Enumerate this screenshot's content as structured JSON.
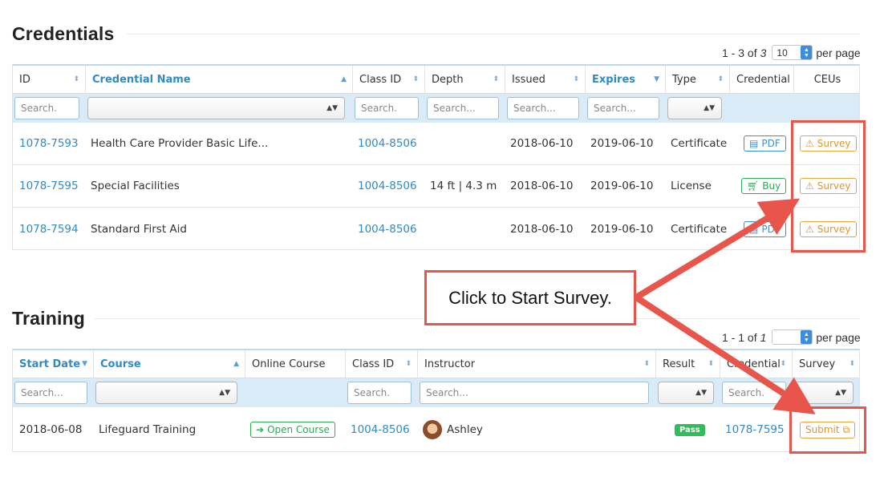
{
  "credentials": {
    "title": "Credentials",
    "pager": {
      "range": "1 - 3 of",
      "total": "3",
      "per_page_value": "10",
      "per_page_label": "per page"
    },
    "columns": [
      {
        "label": "ID",
        "sort": "both"
      },
      {
        "label": "Credential Name",
        "sort": "asc"
      },
      {
        "label": "Class ID",
        "sort": "both"
      },
      {
        "label": "Depth",
        "sort": "both"
      },
      {
        "label": "Issued",
        "sort": "both"
      },
      {
        "label": "Expires",
        "sort": "desc"
      },
      {
        "label": "Type",
        "sort": "both"
      },
      {
        "label": "Credential",
        "sort": "none"
      },
      {
        "label": "CEUs",
        "sort": "none"
      }
    ],
    "filters": {
      "id": "Search.",
      "class_id": "Search.",
      "depth": "Search...",
      "issued": "Search...",
      "expires": "Search..."
    },
    "rows": [
      {
        "id": "1078-7593",
        "name": "Health Care Provider Basic Life...",
        "class_id": "1004-8506",
        "depth": "",
        "issued": "2018-06-10",
        "expires": "2019-06-10",
        "type": "Certificate",
        "credential_btn": "PDF",
        "credential_kind": "pdf",
        "ceus_btn": "Survey"
      },
      {
        "id": "1078-7595",
        "name": "Special Facilities",
        "class_id": "1004-8506",
        "depth": "14 ft | 4.3 m",
        "issued": "2018-06-10",
        "expires": "2019-06-10",
        "type": "License",
        "credential_btn": "Buy",
        "credential_kind": "buy",
        "ceus_btn": "Survey"
      },
      {
        "id": "1078-7594",
        "name": "Standard First Aid",
        "class_id": "1004-8506",
        "depth": "",
        "issued": "2018-06-10",
        "expires": "2019-06-10",
        "type": "Certificate",
        "credential_btn": "PDF",
        "credential_kind": "pdf",
        "ceus_btn": "Survey"
      }
    ]
  },
  "training": {
    "title": "Training",
    "pager": {
      "range": "1 - 1 of",
      "total": "1",
      "per_page_value": "",
      "per_page_label": "per page"
    },
    "columns": [
      {
        "label": "Start Date",
        "sort": "desc"
      },
      {
        "label": "Course",
        "sort": "asc"
      },
      {
        "label": "Online Course",
        "sort": "none"
      },
      {
        "label": "Class ID",
        "sort": "both"
      },
      {
        "label": "Instructor",
        "sort": "both"
      },
      {
        "label": "Result",
        "sort": "both"
      },
      {
        "label": "Credential",
        "sort": "both"
      },
      {
        "label": "Survey",
        "sort": "both"
      }
    ],
    "filters": {
      "start_date": "Search...",
      "class_id": "Search.",
      "instructor": "Search...",
      "credential": "Search."
    },
    "rows": [
      {
        "start_date": "2018-06-08",
        "course": "Lifeguard Training",
        "online_btn": "Open Course",
        "class_id": "1004-8506",
        "instructor": "Ashley",
        "result": "Pass",
        "credential": "1078-7595",
        "survey_btn": "Submit"
      }
    ]
  },
  "callout": {
    "text": "Click to Start Survey."
  },
  "colors": {
    "accent": "#2f8ac6",
    "warning": "#e2952a",
    "success": "#27ae4f",
    "annotation_red": "#e8554b",
    "filter_bg": "#d9ebf6"
  }
}
